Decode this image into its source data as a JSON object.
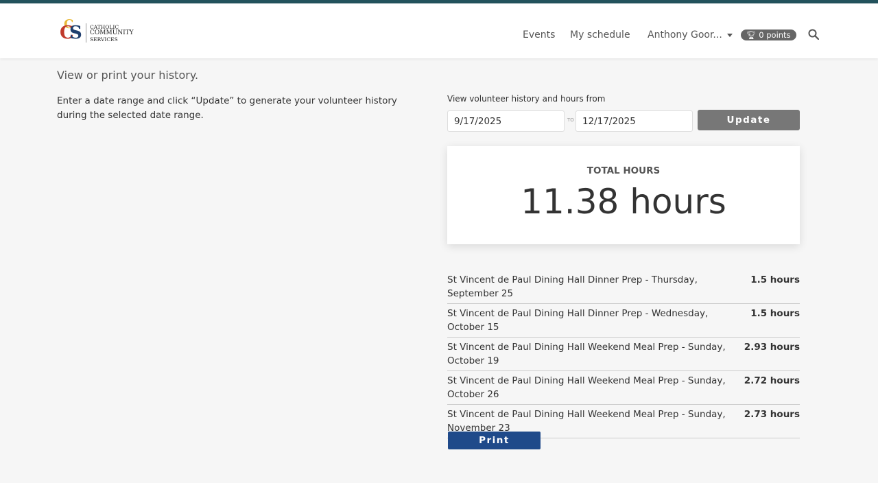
{
  "header": {
    "logo_text": [
      "CATHOLIC",
      "COMMUNITY",
      "SERVICES"
    ],
    "nav": {
      "events": "Events",
      "schedule": "My schedule",
      "user": "Anthony Goor...",
      "points": "0 points"
    }
  },
  "main": {
    "title": "View or print your history.",
    "intro": "Enter a date range and click “Update” to generate your volunteer history during the selected date range.",
    "range_label": "View volunteer history and hours from",
    "from": "9/17/2025",
    "to_label": "TO",
    "to": "12/17/2025",
    "update": "Update",
    "total_label": "TOTAL HOURS",
    "total_value": "11.38 hours",
    "history": [
      {
        "name": "St Vincent de Paul Dining Hall Dinner Prep - Thursday, September 25",
        "hours": "1.5 hours"
      },
      {
        "name": "St Vincent de Paul Dining Hall Dinner Prep - Wednesday, October 15",
        "hours": "1.5 hours"
      },
      {
        "name": "St Vincent de Paul Dining Hall Weekend Meal Prep - Sunday, October 19",
        "hours": "2.93 hours"
      },
      {
        "name": "St Vincent de Paul Dining Hall Weekend Meal Prep - Sunday, October 26",
        "hours": "2.72 hours"
      },
      {
        "name": "St Vincent de Paul Dining Hall Weekend Meal Prep - Sunday, November 23",
        "hours": "2.73 hours"
      }
    ],
    "print": "Print"
  },
  "colors": {
    "topbar": "#23525c",
    "print": "#1f4a8a",
    "update": "#777777"
  }
}
